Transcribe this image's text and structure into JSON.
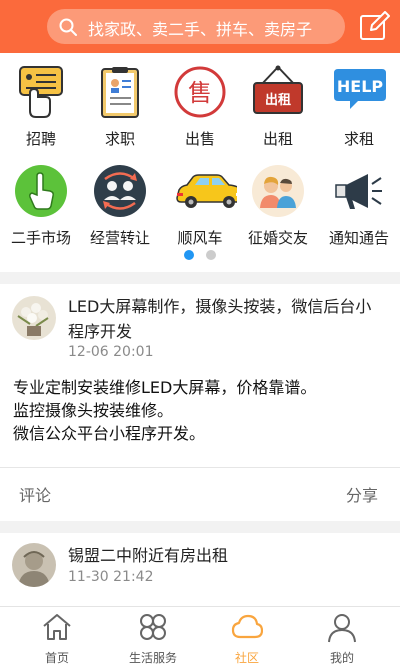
{
  "header": {
    "search_placeholder": "找家政、卖二手、拼车、卖房子",
    "icons": [
      "search-icon",
      "post-edit-icon"
    ]
  },
  "categories": [
    {
      "label": "招聘",
      "icon": "recruit-icon"
    },
    {
      "label": "求职",
      "icon": "resume-icon"
    },
    {
      "label": "出售",
      "icon": "sale-icon",
      "glyph": "售"
    },
    {
      "label": "出租",
      "icon": "rent-sign-icon",
      "glyph": "出租"
    },
    {
      "label": "求租",
      "icon": "help-icon",
      "glyph": "HELP"
    },
    {
      "label": "二手市场",
      "icon": "hand-pointer-icon"
    },
    {
      "label": "经营转让",
      "icon": "transfer-users-icon"
    },
    {
      "label": "顺风车",
      "icon": "car-icon"
    },
    {
      "label": "征婚交友",
      "icon": "couple-icon"
    },
    {
      "label": "通知通告",
      "icon": "megaphone-icon"
    }
  ],
  "pager": {
    "pages": 2,
    "current": 1
  },
  "posts": [
    {
      "title": "LED大屏幕制作，摄像头按装，微信后台小程序开发",
      "time": "12-06 20:01",
      "body_lines": [
        "专业定制安装维修LED大屏幕，价格靠谱。",
        "监控摄像头按装维修。",
        "微信公众平台小程序开发。"
      ],
      "comment_label": "评论",
      "share_label": "分享"
    },
    {
      "title": "锡盟二中附近有房出租",
      "time": "11-30 21:42"
    }
  ],
  "nav": {
    "tabs": [
      {
        "label": "首页",
        "icon": "home-icon"
      },
      {
        "label": "生活服务",
        "icon": "services-grid-icon"
      },
      {
        "label": "社区",
        "icon": "cloud-icon",
        "active": true
      },
      {
        "label": "我的",
        "icon": "profile-icon"
      }
    ]
  },
  "colors": {
    "brand": "#fb6a3c",
    "active_tab": "#f9a53e",
    "pager_active": "#2196f3",
    "pager_inactive": "#cccccc"
  }
}
